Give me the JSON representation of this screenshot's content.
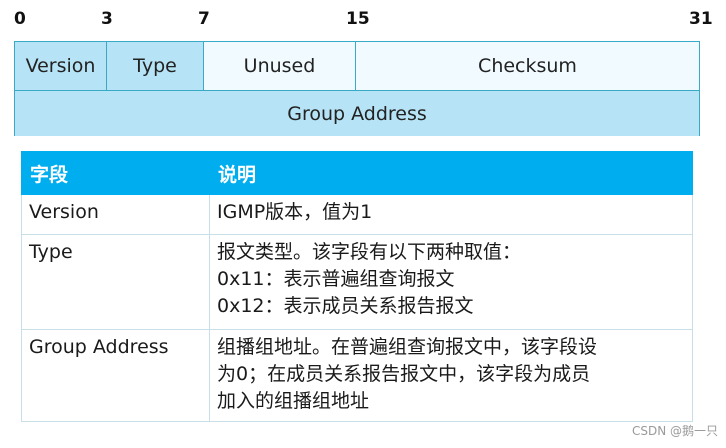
{
  "bit_positions": [
    "0",
    "3",
    "7",
    "15",
    "31"
  ],
  "header_fields": {
    "version": "Version",
    "type": "Type",
    "unused": "Unused",
    "checksum": "Checksum",
    "group_address": "Group Address"
  },
  "table": {
    "columns": [
      "字段",
      "说明"
    ],
    "rows": [
      {
        "field": "Version",
        "lines": [
          "IGMP版本，值为1"
        ]
      },
      {
        "field": "Type",
        "lines": [
          "报文类型。该字段有以下两种取值：",
          "0x11：表示普遍组查询报文",
          "0x12：表示成员关系报告报文"
        ]
      },
      {
        "field": "Group Address",
        "lines": [
          "组播组地址。在普遍组查询报文中，该字段设",
          "为0；在成员关系报告报文中，该字段为成员",
          "加入的组播组地址"
        ]
      }
    ]
  },
  "watermark": "CSDN @鹅一只"
}
